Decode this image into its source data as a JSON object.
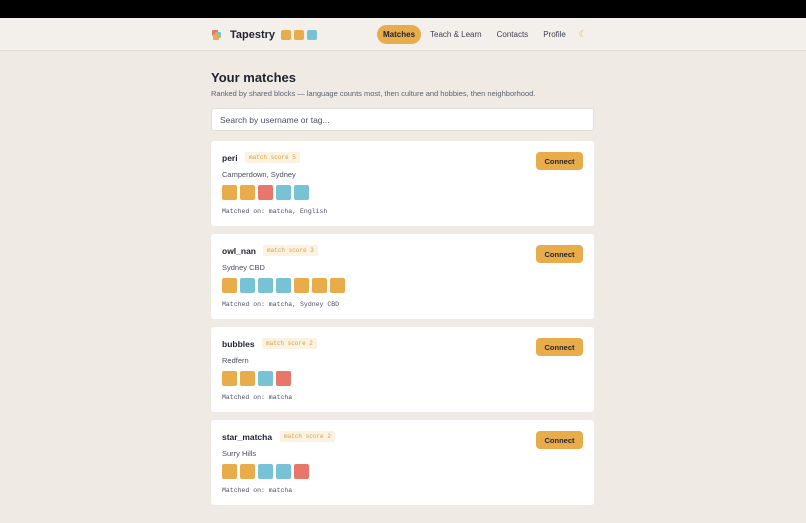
{
  "app": {
    "name": "Tapestry",
    "brand_blocks": [
      "#e8ac4a",
      "#e8ac4a",
      "#77c3d5"
    ]
  },
  "nav": {
    "items": [
      {
        "label": "Matches",
        "active": true
      },
      {
        "label": "Teach & Learn",
        "active": false
      },
      {
        "label": "Contacts",
        "active": false
      },
      {
        "label": "Profile",
        "active": false
      }
    ],
    "theme_icon": "moon-icon"
  },
  "page": {
    "title": "Your matches",
    "subtitle": "Ranked by shared blocks — language counts most, then culture and hobbies, then neighborhood."
  },
  "search": {
    "placeholder": "Search by username or tag...",
    "value": ""
  },
  "colors": {
    "accent": "#e8ac4a",
    "blue": "#77c3d5",
    "red": "#e8766a",
    "background": "#efebe4"
  },
  "matches": [
    {
      "username": "peri",
      "score": "match score 5",
      "location": "Camperdown, Sydney",
      "blocks": [
        "#e8ac4a",
        "#e8ac4a",
        "#e8766a",
        "#77c3d5",
        "#77c3d5"
      ],
      "matched_on": "Matched on: matcha, English",
      "connect_label": "Connect"
    },
    {
      "username": "owl_nan",
      "score": "match score 3",
      "location": "Sydney CBD",
      "blocks": [
        "#e8ac4a",
        "#77c3d5",
        "#77c3d5",
        "#77c3d5",
        "#e8ac4a",
        "#e8ac4a",
        "#e8ac4a"
      ],
      "matched_on": "Matched on: matcha, Sydney CBD",
      "connect_label": "Connect"
    },
    {
      "username": "bubbles",
      "score": "match score 2",
      "location": "Redfern",
      "blocks": [
        "#e8ac4a",
        "#e8ac4a",
        "#77c3d5",
        "#e8766a"
      ],
      "matched_on": "Matched on: matcha",
      "connect_label": "Connect"
    },
    {
      "username": "star_matcha",
      "score": "match score 2",
      "location": "Surry Hills",
      "blocks": [
        "#e8ac4a",
        "#e8ac4a",
        "#77c3d5",
        "#77c3d5",
        "#e8766a"
      ],
      "matched_on": "Matched on: matcha",
      "connect_label": "Connect"
    }
  ]
}
